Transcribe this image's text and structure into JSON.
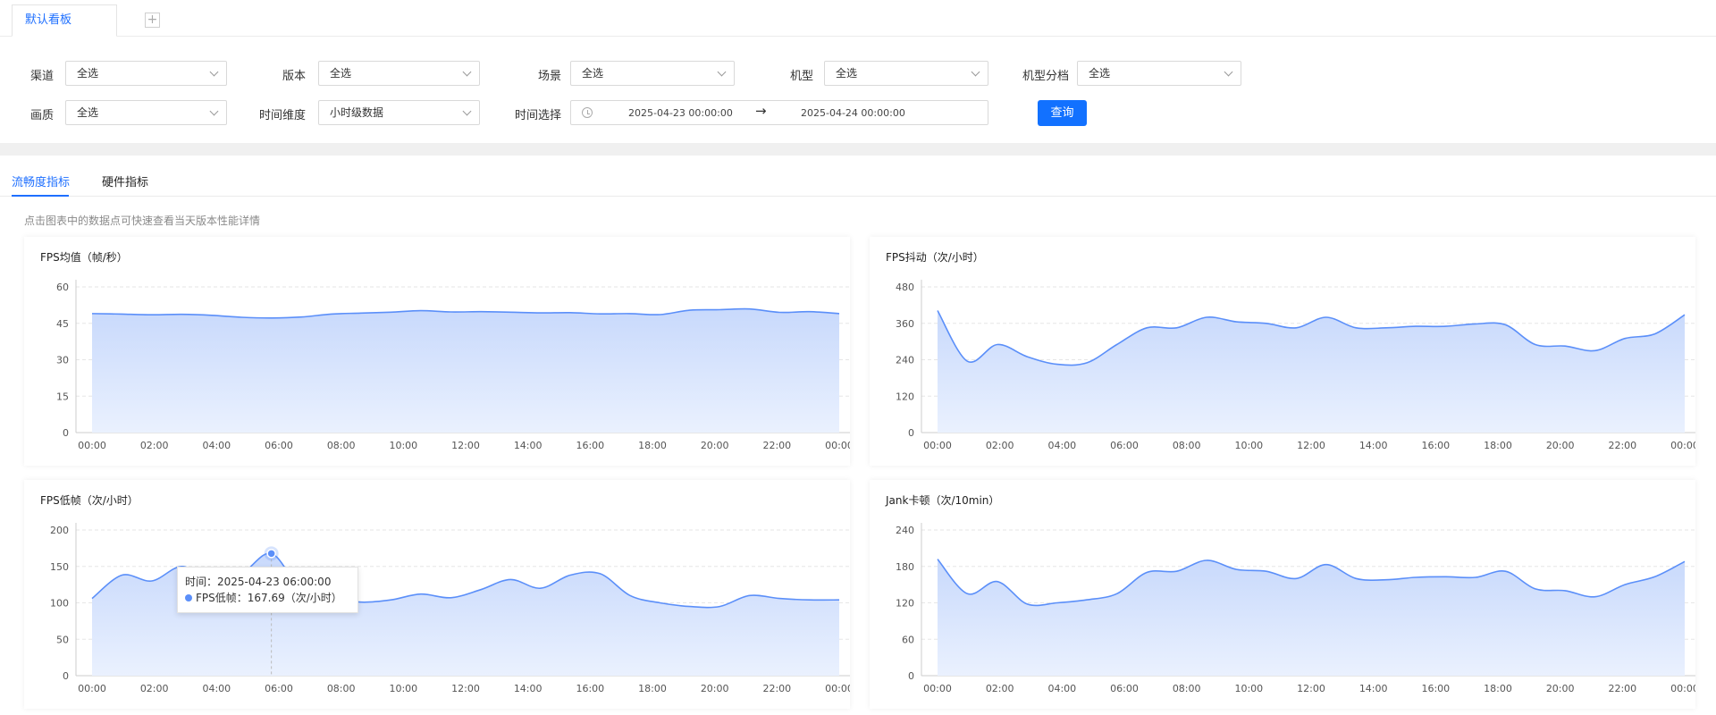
{
  "tabs": {
    "default_label": "默认看板",
    "add_label": "+"
  },
  "filters": {
    "row1": [
      {
        "label": "渠道",
        "value": "全选"
      },
      {
        "label": "版本",
        "value": "全选"
      },
      {
        "label": "场景",
        "value": "全选"
      },
      {
        "label": "机型",
        "value": "全选"
      },
      {
        "label": "机型分档",
        "value": "全选"
      }
    ],
    "row2": [
      {
        "label": "画质",
        "value": "全选"
      },
      {
        "label": "时间维度",
        "value": "小时级数据"
      }
    ],
    "time_label": "时间选择",
    "time_start": "2025-04-23 00:00:00",
    "time_arrow": "→",
    "time_end": "2025-04-24 00:00:00",
    "query_button": "查询"
  },
  "subtabs": {
    "fluency": "流畅度指标",
    "hardware": "硬件指标"
  },
  "hint": "点击图表中的数据点可快速查看当天版本性能详情",
  "colors": {
    "accent": "#1e6fff",
    "series_line": "#5b8ff9",
    "area_top": "#c8d9fc",
    "area_bottom": "#eaf1fe"
  },
  "x_labels": [
    "00:00",
    "02:00",
    "04:00",
    "06:00",
    "08:00",
    "10:00",
    "12:00",
    "14:00",
    "16:00",
    "18:00",
    "20:00",
    "22:00",
    "00:00"
  ],
  "charts": [
    {
      "title": "FPS均值（帧/秒）",
      "chart_data": {
        "type": "area",
        "ylim": [
          0,
          60
        ],
        "yticks": [
          0,
          15,
          30,
          45,
          60
        ],
        "values": [
          49,
          48.8,
          48.5,
          48.7,
          48.3,
          47.5,
          47.2,
          47.6,
          48.8,
          49.2,
          49.6,
          50.2,
          49.7,
          49.8,
          49.6,
          49.3,
          49.4,
          48.9,
          49.0,
          48.6,
          50.4,
          50.6,
          50.9,
          49.5,
          49.8,
          49.0
        ]
      }
    },
    {
      "title": "FPS抖动（次/小时）",
      "chart_data": {
        "type": "area",
        "ylim": [
          0,
          480
        ],
        "yticks": [
          0,
          120,
          240,
          360,
          480
        ],
        "values": [
          402,
          235,
          290,
          250,
          225,
          230,
          290,
          345,
          345,
          380,
          365,
          360,
          345,
          380,
          345,
          345,
          350,
          350,
          358,
          355,
          290,
          285,
          270,
          310,
          325,
          388
        ]
      }
    },
    {
      "title": "FPS低帧（次/小时）",
      "chart_data": {
        "type": "area",
        "ylim": [
          0,
          200
        ],
        "yticks": [
          0,
          50,
          100,
          150,
          200
        ],
        "values": [
          106,
          138,
          130,
          150,
          132,
          140,
          167.69,
          118,
          108,
          101,
          104,
          112,
          107,
          118,
          132,
          120,
          138,
          140,
          110,
          100,
          95,
          95,
          110,
          106,
          104,
          104
        ]
      }
    },
    {
      "title": "Jank卡顿（次/10min）",
      "chart_data": {
        "type": "area",
        "ylim": [
          0,
          240
        ],
        "yticks": [
          0,
          60,
          120,
          180,
          240
        ],
        "values": [
          192,
          135,
          155,
          118,
          120,
          125,
          135,
          170,
          172,
          190,
          175,
          172,
          160,
          183,
          160,
          158,
          162,
          163,
          162,
          172,
          143,
          140,
          130,
          150,
          163,
          188
        ]
      }
    }
  ],
  "tooltip": {
    "time_text": "时间：2025-04-23 06:00:00",
    "series_text": "FPS低帧：167.69（次/小时）"
  }
}
